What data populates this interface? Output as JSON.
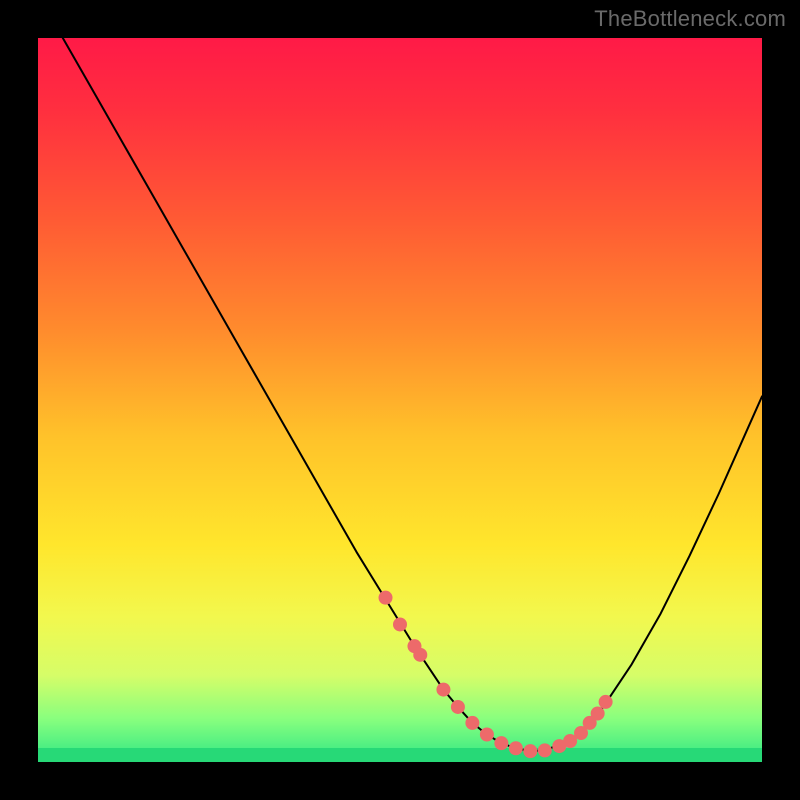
{
  "watermark": {
    "text": "TheBottleneck.com"
  },
  "gradient": {
    "stops": [
      {
        "offset": 0.0,
        "color": "#ff1a47"
      },
      {
        "offset": 0.1,
        "color": "#ff2f3f"
      },
      {
        "offset": 0.25,
        "color": "#ff5a34"
      },
      {
        "offset": 0.4,
        "color": "#ff8a2d"
      },
      {
        "offset": 0.55,
        "color": "#ffc22a"
      },
      {
        "offset": 0.7,
        "color": "#ffe62c"
      },
      {
        "offset": 0.8,
        "color": "#f2f84e"
      },
      {
        "offset": 0.88,
        "color": "#d6fd68"
      },
      {
        "offset": 0.94,
        "color": "#89ff7e"
      },
      {
        "offset": 1.0,
        "color": "#2fe785"
      }
    ]
  },
  "chart_data": {
    "type": "line",
    "title": "",
    "xlabel": "",
    "ylabel": "",
    "xlim": [
      0,
      100
    ],
    "ylim": [
      0,
      100
    ],
    "grid": false,
    "legend": false,
    "x": [
      0,
      4,
      8,
      12,
      16,
      20,
      24,
      28,
      32,
      36,
      40,
      44,
      48,
      52,
      56,
      58,
      60,
      62,
      64,
      66,
      68,
      70,
      74,
      78,
      82,
      86,
      90,
      94,
      98,
      100
    ],
    "values": [
      106,
      99,
      92,
      85,
      78,
      71,
      64,
      57,
      50,
      43,
      36,
      29,
      22.5,
      16,
      10,
      7.6,
      5.4,
      3.8,
      2.6,
      1.9,
      1.5,
      1.6,
      3.2,
      7.5,
      13.5,
      20.5,
      28.5,
      37,
      46,
      50.5
    ],
    "markers": {
      "x": [
        48,
        50,
        52,
        52.8,
        56,
        58,
        60,
        62,
        64,
        66,
        68,
        70,
        72,
        73.5,
        75,
        76.2,
        77.3,
        78.4
      ],
      "values": [
        22.7,
        19.0,
        16.0,
        14.8,
        10.0,
        7.6,
        5.4,
        3.8,
        2.6,
        1.9,
        1.5,
        1.6,
        2.2,
        2.9,
        4.0,
        5.4,
        6.7,
        8.3
      ]
    },
    "marker_color": "#ed6a6a",
    "line_color": "#000000"
  }
}
